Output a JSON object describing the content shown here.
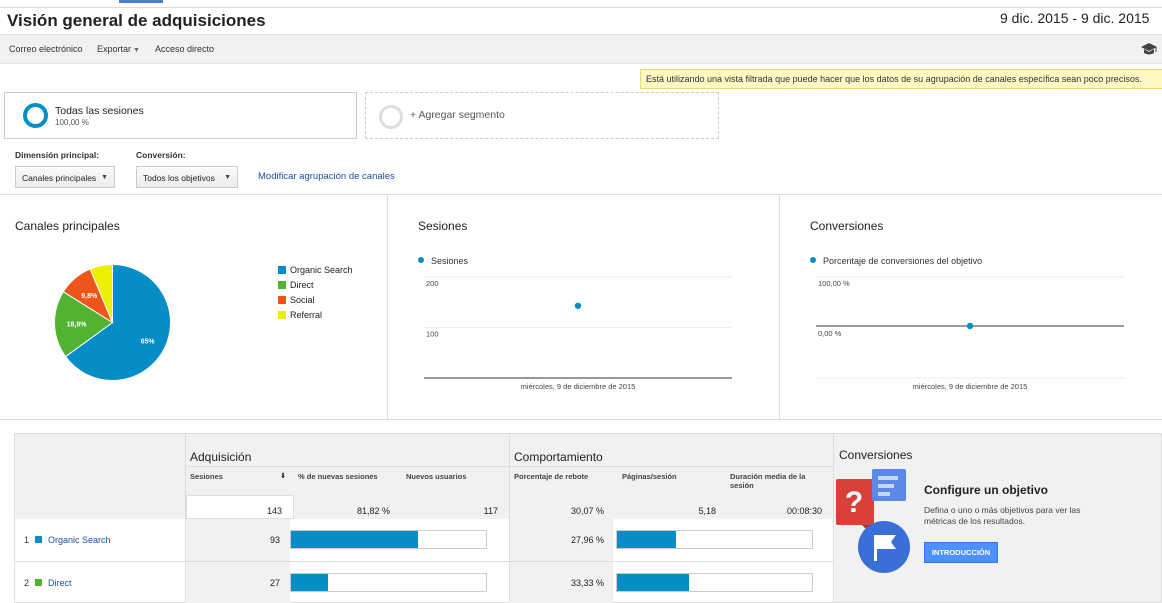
{
  "header": {
    "title": "Visión general de adquisiciones",
    "date_range": "9 dic. 2015 - 9 dic. 2015"
  },
  "toolbar": {
    "email": "Correo electrónico",
    "export": "Exportar",
    "shortcut": "Acceso directo"
  },
  "notice": "Está utilizando una vista filtrada que puede hacer que los datos de su agrupación de canales específica sean poco precisos.",
  "segments": {
    "active_name": "Todas las sesiones",
    "active_pct": "100,00 %",
    "add_label": "+ Agregar segmento"
  },
  "controls": {
    "dimension_label": "Dimensión principal:",
    "dimension_value": "Canales principales",
    "conversion_label": "Conversión:",
    "conversion_value": "Todos los objetivos",
    "modify_link": "Modificar agrupación de canales"
  },
  "panels": {
    "channels_title": "Canales principales",
    "sessions_title": "Sesiones",
    "sessions_legend": "Sesiones",
    "conversions_title": "Conversiones",
    "conversions_legend": "Porcentaje de conversiones del objetivo"
  },
  "colors": {
    "organic": "#058dc7",
    "direct": "#50b432",
    "social": "#ed561b",
    "referral": "#edef00"
  },
  "chart_data": [
    {
      "type": "pie",
      "title": "Canales principales",
      "categories": [
        "Organic Search",
        "Direct",
        "Social",
        "Referral"
      ],
      "values": [
        65,
        18.9,
        9.8,
        6.3
      ],
      "slice_labels": [
        "65%",
        "18,9%",
        "9,8%",
        ""
      ],
      "colors": [
        "#058dc7",
        "#50b432",
        "#ed561b",
        "#edef00"
      ],
      "legend": "right"
    },
    {
      "type": "scatter",
      "title": "Sesiones",
      "series": [
        {
          "name": "Sesiones",
          "x": [
            "miércoles, 9 de diciembre de 2015"
          ],
          "y": [
            143
          ]
        }
      ],
      "yticks": [
        "200",
        "100"
      ],
      "ylim": [
        0,
        200
      ],
      "xlabel_text": "miércoles, 9 de diciembre de 2015"
    },
    {
      "type": "scatter",
      "title": "Conversiones",
      "series": [
        {
          "name": "Porcentaje de conversiones del objetivo",
          "x": [
            "miércoles, 9 de diciembre de 2015"
          ],
          "y": [
            0
          ]
        }
      ],
      "yticks": [
        "100,00 %",
        "0,00 %"
      ],
      "ylim": [
        0,
        100
      ],
      "xlabel_text": "miércoles, 9 de diciembre de 2015"
    }
  ],
  "table": {
    "group_acquisition": "Adquisición",
    "group_behavior": "Comportamiento",
    "group_conversions": "Conversiones",
    "col_sessions": "Sesiones",
    "col_new_sessions_pct": "% de nuevas sesiones",
    "col_new_users": "Nuevos usuarios",
    "col_bounce": "Porcentaje de rebote",
    "col_pages": "Páginas/sesión",
    "col_duration": "Duración media de la sesión",
    "totals": {
      "sessions": "143",
      "new_sessions_pct": "81,82 %",
      "new_users": "117",
      "bounce": "30,07 %",
      "pages": "5,18",
      "duration": "00:08:30"
    },
    "rows": [
      {
        "index": "1",
        "name": "Organic Search",
        "sessions": "93",
        "sessions_share": 0.65,
        "bounce": "27,96 %",
        "bounce_share": 0.3
      },
      {
        "index": "2",
        "name": "Direct",
        "sessions": "27",
        "sessions_share": 0.19,
        "bounce": "33,33 %",
        "bounce_share": 0.37
      }
    ]
  },
  "goal": {
    "heading": "Configure un objetivo",
    "description": "Defina o uno o más objetivos para ver las métricas de los resultados.",
    "button": "INTRODUCCIÓN"
  }
}
